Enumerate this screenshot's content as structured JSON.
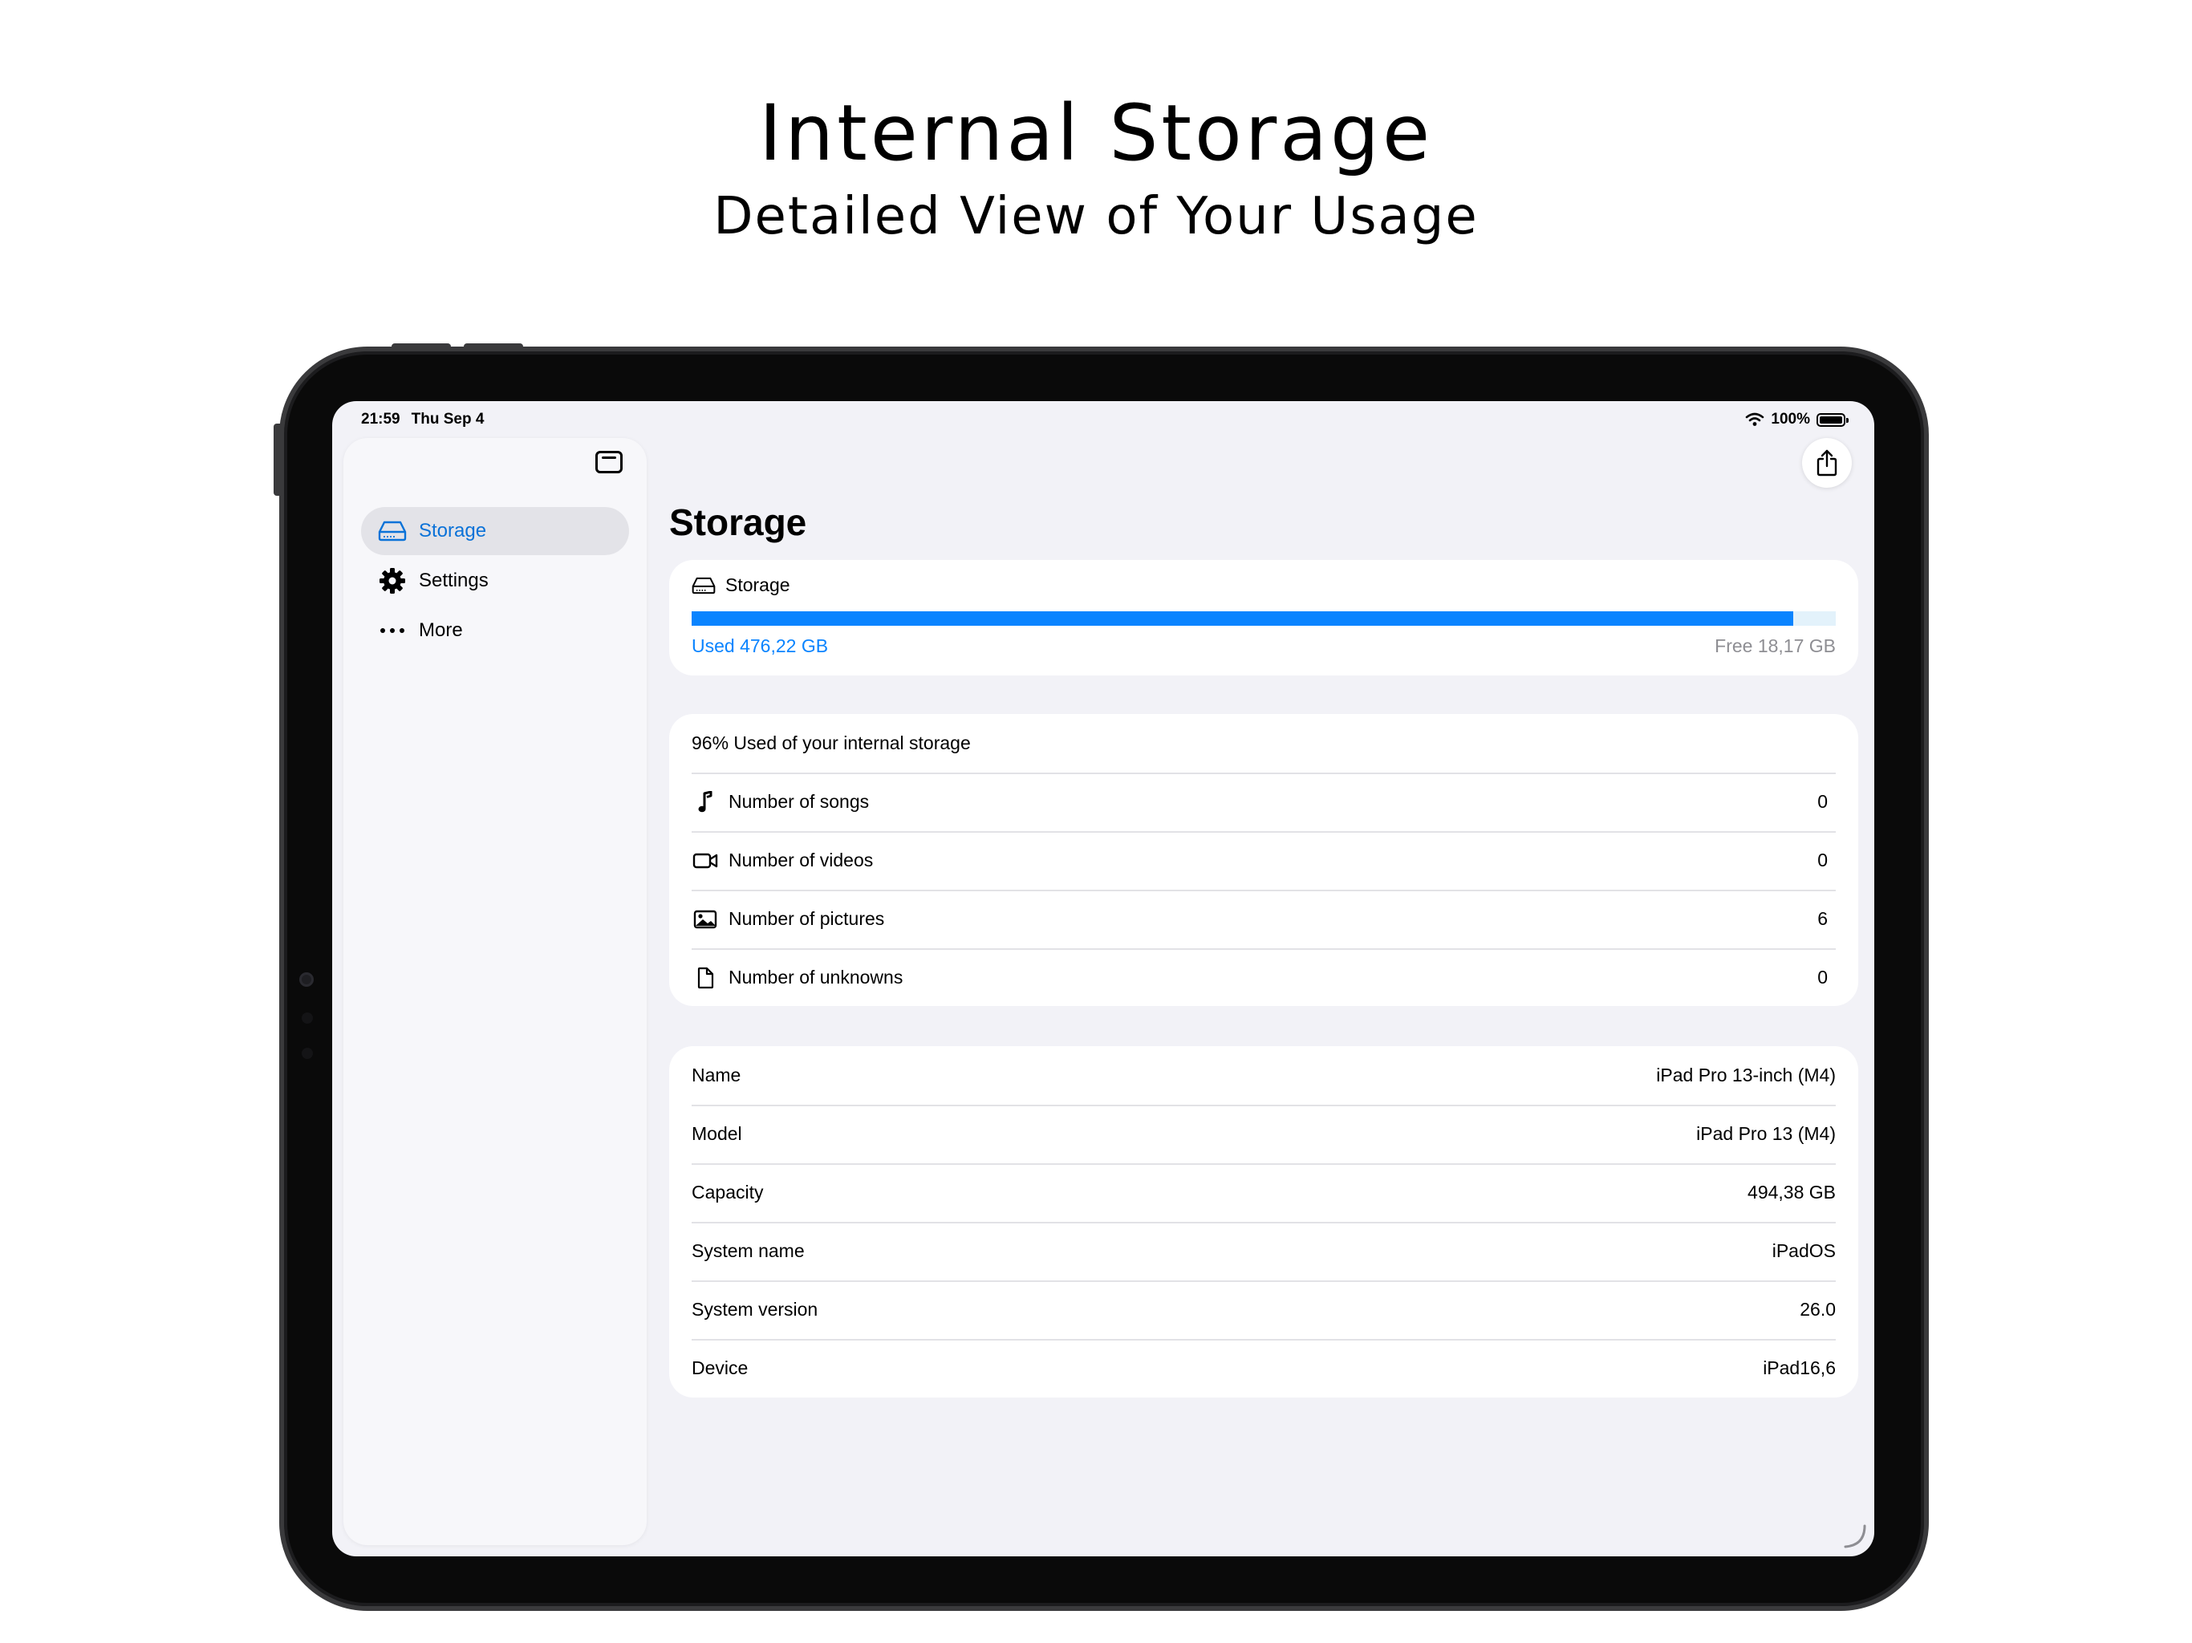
{
  "promo": {
    "title": "Internal Storage",
    "subtitle": "Detailed View of Your Usage"
  },
  "status_bar": {
    "time": "21:59",
    "date": "Thu Sep 4",
    "battery": "100%"
  },
  "sidebar": {
    "items": [
      {
        "label": "Storage",
        "icon": "drive-icon",
        "selected": true
      },
      {
        "label": "Settings",
        "icon": "gear-icon",
        "selected": false
      },
      {
        "label": "More",
        "icon": "more-icon",
        "selected": false
      }
    ]
  },
  "main": {
    "title": "Storage",
    "storage_card": {
      "label": "Storage",
      "used": "Used 476,22 GB",
      "free": "Free 18,17 GB",
      "used_fraction": 0.963
    },
    "counts_card": {
      "summary": "96% Used of your internal storage",
      "rows": [
        {
          "label": "Number of songs",
          "value": "0",
          "icon": "music-note-icon"
        },
        {
          "label": "Number of videos",
          "value": "0",
          "icon": "video-camera-icon"
        },
        {
          "label": "Number of pictures",
          "value": "6",
          "icon": "photo-icon"
        },
        {
          "label": "Number of unknowns",
          "value": "0",
          "icon": "document-icon"
        }
      ]
    },
    "info_card": {
      "rows": [
        {
          "label": "Name",
          "value": "iPad Pro 13-inch (M4)"
        },
        {
          "label": "Model",
          "value": "iPad Pro 13 (M4)"
        },
        {
          "label": "Capacity",
          "value": "494,38 GB"
        },
        {
          "label": "System name",
          "value": "iPadOS"
        },
        {
          "label": "System version",
          "value": "26.0"
        },
        {
          "label": "Device",
          "value": "iPad16,6"
        }
      ]
    }
  },
  "colors": {
    "accent": "#0a84ff",
    "link": "#0a72d8",
    "background": "#f2f2f7",
    "card": "#ffffff",
    "secondary_text": "#8e8e93"
  }
}
